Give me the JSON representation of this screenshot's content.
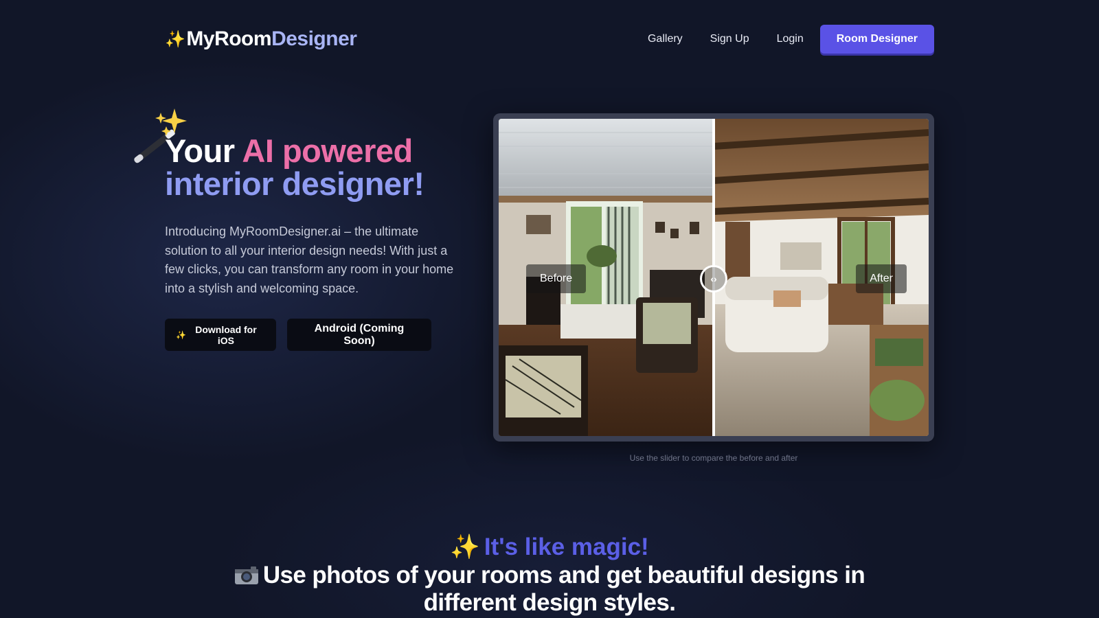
{
  "header": {
    "logo_sparkle": "✨",
    "logo_part1": "MyRoom",
    "logo_part2": "Designer",
    "nav": {
      "gallery": "Gallery",
      "signup": "Sign Up",
      "login": "Login",
      "cta": "Room Designer"
    }
  },
  "hero": {
    "title_white": "Your ",
    "title_pink": "AI powered",
    "title_indigo": "interior designer!",
    "description": "Introducing MyRoomDesigner.ai – the ultimate solution to all your interior design needs! With just a few clicks, you can transform any room in your home into a stylish and welcoming space.",
    "ios_sparkle": "✨",
    "ios_button": "Download for iOS",
    "android_button": "Android (Coming Soon)"
  },
  "compare": {
    "before_label": "Before",
    "after_label": "After",
    "caption": "Use the slider to compare the before and after",
    "slider_position": 0.5
  },
  "magic": {
    "sparkle": "✨",
    "headline": "It's like magic!",
    "subheadline": "Use photos of your rooms and get beautiful designs in different design styles."
  },
  "colors": {
    "background": "#111628",
    "accent_button": "#5a52e6",
    "pink": "#ec6fa8",
    "indigo": "#8f9cf2",
    "magic_indigo": "#5b5fe6"
  },
  "icons": [
    "sparkle-icon",
    "magic-wand-icon",
    "camera-icon",
    "slider-arrows-icon"
  ]
}
